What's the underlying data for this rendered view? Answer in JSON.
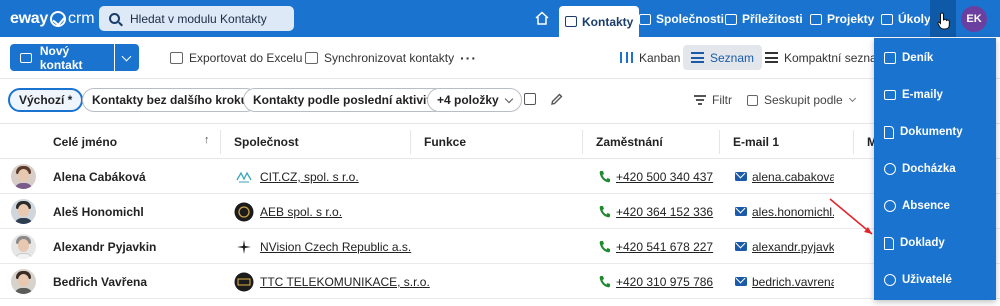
{
  "app": {
    "logo_part1": "eway",
    "logo_part2": "crm",
    "search_placeholder": "Hledat v modulu Kontakty",
    "user_initials": "EK",
    "accent_color": "#1a73cf"
  },
  "topnav": {
    "home_icon": "home-icon",
    "items": [
      {
        "label": "Kontakty",
        "icon": "contact-card-icon",
        "active": true
      },
      {
        "label": "Společnosti",
        "icon": "building-icon"
      },
      {
        "label": "Příležitosti",
        "icon": "opportunity-icon"
      },
      {
        "label": "Projekty",
        "icon": "project-icon"
      },
      {
        "label": "Úkoly",
        "icon": "task-icon"
      }
    ]
  },
  "toolbar": {
    "new_contact": "Nový kontakt",
    "export_excel": "Exportovat do Excelu",
    "sync_contacts": "Synchronizovat kontakty",
    "more": "···",
    "views": [
      {
        "label": "Kanban"
      },
      {
        "label": "Seznam",
        "active": true
      },
      {
        "label": "Kompaktní seznam"
      }
    ]
  },
  "filters": {
    "chips": [
      {
        "label": "Výchozí *",
        "active": true
      },
      {
        "label": "Kontakty bez dalšího kroku"
      },
      {
        "label": "Kontakty podle poslední aktivity"
      },
      {
        "label": "+4 položky"
      }
    ],
    "filter_label": "Filtr",
    "group_label": "Seskupit podle"
  },
  "table": {
    "columns": [
      "Celé jméno",
      "Společnost",
      "Funkce",
      "Zaměstnání",
      "E-mail 1",
      "M"
    ],
    "sort_indicator": "↑",
    "rows": [
      {
        "name": "Alena Cabáková",
        "company": "CIT.CZ, spol. s r.o.",
        "phone": "+420 500 340 437",
        "email": "alena.cabakova..."
      },
      {
        "name": "Aleš Honomichl",
        "company": "AEB spol. s r.o.",
        "phone": "+420 364 152 336",
        "email": "ales.honomichl..."
      },
      {
        "name": "Alexandr Pyjavkin",
        "company": "NVision Czech Republic a.s.",
        "phone": "+420 541 678 227",
        "email": "alexandr.pyjavki..."
      },
      {
        "name": "Bedřich Vavřena",
        "company": "TTC TELEKOMUNIKACE, s.r.o.",
        "phone": "+420 310 975 786",
        "email": "bedrich.vavrena..."
      }
    ]
  },
  "dropdown": {
    "items": [
      {
        "label": "Deník",
        "icon": "journal-icon"
      },
      {
        "label": "E-maily",
        "icon": "mail-icon"
      },
      {
        "label": "Dokumenty",
        "icon": "document-icon"
      },
      {
        "label": "Docházka",
        "icon": "clock-icon"
      },
      {
        "label": "Absence",
        "icon": "smiley-icon"
      },
      {
        "label": "Doklady",
        "icon": "receipt-icon"
      },
      {
        "label": "Uživatelé",
        "icon": "users-icon"
      }
    ]
  }
}
